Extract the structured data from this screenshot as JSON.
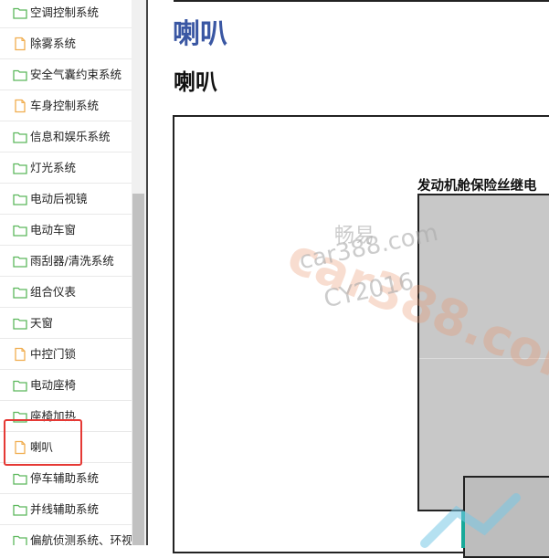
{
  "sidebar": {
    "items": [
      {
        "label": "空调控制系统",
        "icon": "folder-icon"
      },
      {
        "label": "除雾系统",
        "icon": "document-icon"
      },
      {
        "label": "安全气囊约束系统",
        "icon": "folder-icon"
      },
      {
        "label": "车身控制系统",
        "icon": "document-icon"
      },
      {
        "label": "信息和娱乐系统",
        "icon": "folder-icon"
      },
      {
        "label": "灯光系统",
        "icon": "folder-icon"
      },
      {
        "label": "电动后视镜",
        "icon": "folder-icon"
      },
      {
        "label": "电动车窗",
        "icon": "folder-icon"
      },
      {
        "label": "雨刮器/清洗系统",
        "icon": "folder-icon"
      },
      {
        "label": "组合仪表",
        "icon": "folder-icon"
      },
      {
        "label": "天窗",
        "icon": "folder-icon"
      },
      {
        "label": "中控门锁",
        "icon": "document-icon"
      },
      {
        "label": "电动座椅",
        "icon": "folder-icon"
      },
      {
        "label": "座椅加热",
        "icon": "folder-icon"
      },
      {
        "label": "喇叭",
        "icon": "document-icon",
        "selected": true
      },
      {
        "label": "停车辅助系统",
        "icon": "folder-icon"
      },
      {
        "label": "并线辅助系统",
        "icon": "folder-icon"
      },
      {
        "label": "偏航侦测系统、环视",
        "icon": "folder-icon"
      }
    ]
  },
  "main": {
    "title": "喇叭",
    "subtitle": "喇叭",
    "diagram": {
      "fuse_box_label": "发动机舱保险丝继电"
    }
  },
  "watermark": {
    "logo": "car388.com",
    "brand": "畅易",
    "site": "car388.com",
    "id": "CY2016"
  },
  "colors": {
    "title": "#3a57a3",
    "folder_icon": "#5cb85c",
    "document_icon": "#f0ad4e",
    "selection_border": "#e53935"
  }
}
